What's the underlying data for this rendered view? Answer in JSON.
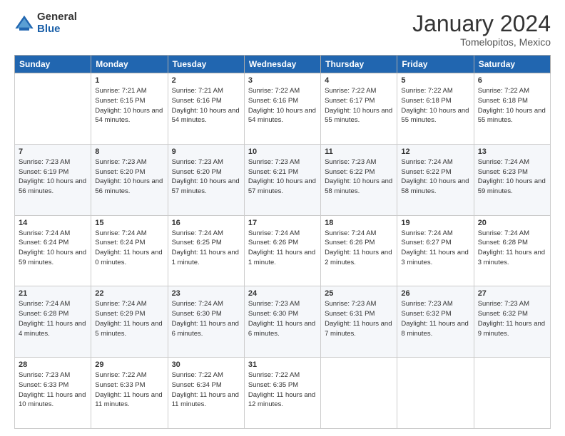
{
  "header": {
    "logo_general": "General",
    "logo_blue": "Blue",
    "main_title": "January 2024",
    "subtitle": "Tomelopitos, Mexico"
  },
  "weekdays": [
    "Sunday",
    "Monday",
    "Tuesday",
    "Wednesday",
    "Thursday",
    "Friday",
    "Saturday"
  ],
  "weeks": [
    [
      {
        "day": "",
        "sunrise": "",
        "sunset": "",
        "daylight": ""
      },
      {
        "day": "1",
        "sunrise": "Sunrise: 7:21 AM",
        "sunset": "Sunset: 6:15 PM",
        "daylight": "Daylight: 10 hours and 54 minutes."
      },
      {
        "day": "2",
        "sunrise": "Sunrise: 7:21 AM",
        "sunset": "Sunset: 6:16 PM",
        "daylight": "Daylight: 10 hours and 54 minutes."
      },
      {
        "day": "3",
        "sunrise": "Sunrise: 7:22 AM",
        "sunset": "Sunset: 6:16 PM",
        "daylight": "Daylight: 10 hours and 54 minutes."
      },
      {
        "day": "4",
        "sunrise": "Sunrise: 7:22 AM",
        "sunset": "Sunset: 6:17 PM",
        "daylight": "Daylight: 10 hours and 55 minutes."
      },
      {
        "day": "5",
        "sunrise": "Sunrise: 7:22 AM",
        "sunset": "Sunset: 6:18 PM",
        "daylight": "Daylight: 10 hours and 55 minutes."
      },
      {
        "day": "6",
        "sunrise": "Sunrise: 7:22 AM",
        "sunset": "Sunset: 6:18 PM",
        "daylight": "Daylight: 10 hours and 55 minutes."
      }
    ],
    [
      {
        "day": "7",
        "sunrise": "Sunrise: 7:23 AM",
        "sunset": "Sunset: 6:19 PM",
        "daylight": "Daylight: 10 hours and 56 minutes."
      },
      {
        "day": "8",
        "sunrise": "Sunrise: 7:23 AM",
        "sunset": "Sunset: 6:20 PM",
        "daylight": "Daylight: 10 hours and 56 minutes."
      },
      {
        "day": "9",
        "sunrise": "Sunrise: 7:23 AM",
        "sunset": "Sunset: 6:20 PM",
        "daylight": "Daylight: 10 hours and 57 minutes."
      },
      {
        "day": "10",
        "sunrise": "Sunrise: 7:23 AM",
        "sunset": "Sunset: 6:21 PM",
        "daylight": "Daylight: 10 hours and 57 minutes."
      },
      {
        "day": "11",
        "sunrise": "Sunrise: 7:23 AM",
        "sunset": "Sunset: 6:22 PM",
        "daylight": "Daylight: 10 hours and 58 minutes."
      },
      {
        "day": "12",
        "sunrise": "Sunrise: 7:24 AM",
        "sunset": "Sunset: 6:22 PM",
        "daylight": "Daylight: 10 hours and 58 minutes."
      },
      {
        "day": "13",
        "sunrise": "Sunrise: 7:24 AM",
        "sunset": "Sunset: 6:23 PM",
        "daylight": "Daylight: 10 hours and 59 minutes."
      }
    ],
    [
      {
        "day": "14",
        "sunrise": "Sunrise: 7:24 AM",
        "sunset": "Sunset: 6:24 PM",
        "daylight": "Daylight: 10 hours and 59 minutes."
      },
      {
        "day": "15",
        "sunrise": "Sunrise: 7:24 AM",
        "sunset": "Sunset: 6:24 PM",
        "daylight": "Daylight: 11 hours and 0 minutes."
      },
      {
        "day": "16",
        "sunrise": "Sunrise: 7:24 AM",
        "sunset": "Sunset: 6:25 PM",
        "daylight": "Daylight: 11 hours and 1 minute."
      },
      {
        "day": "17",
        "sunrise": "Sunrise: 7:24 AM",
        "sunset": "Sunset: 6:26 PM",
        "daylight": "Daylight: 11 hours and 1 minute."
      },
      {
        "day": "18",
        "sunrise": "Sunrise: 7:24 AM",
        "sunset": "Sunset: 6:26 PM",
        "daylight": "Daylight: 11 hours and 2 minutes."
      },
      {
        "day": "19",
        "sunrise": "Sunrise: 7:24 AM",
        "sunset": "Sunset: 6:27 PM",
        "daylight": "Daylight: 11 hours and 3 minutes."
      },
      {
        "day": "20",
        "sunrise": "Sunrise: 7:24 AM",
        "sunset": "Sunset: 6:28 PM",
        "daylight": "Daylight: 11 hours and 3 minutes."
      }
    ],
    [
      {
        "day": "21",
        "sunrise": "Sunrise: 7:24 AM",
        "sunset": "Sunset: 6:28 PM",
        "daylight": "Daylight: 11 hours and 4 minutes."
      },
      {
        "day": "22",
        "sunrise": "Sunrise: 7:24 AM",
        "sunset": "Sunset: 6:29 PM",
        "daylight": "Daylight: 11 hours and 5 minutes."
      },
      {
        "day": "23",
        "sunrise": "Sunrise: 7:24 AM",
        "sunset": "Sunset: 6:30 PM",
        "daylight": "Daylight: 11 hours and 6 minutes."
      },
      {
        "day": "24",
        "sunrise": "Sunrise: 7:23 AM",
        "sunset": "Sunset: 6:30 PM",
        "daylight": "Daylight: 11 hours and 6 minutes."
      },
      {
        "day": "25",
        "sunrise": "Sunrise: 7:23 AM",
        "sunset": "Sunset: 6:31 PM",
        "daylight": "Daylight: 11 hours and 7 minutes."
      },
      {
        "day": "26",
        "sunrise": "Sunrise: 7:23 AM",
        "sunset": "Sunset: 6:32 PM",
        "daylight": "Daylight: 11 hours and 8 minutes."
      },
      {
        "day": "27",
        "sunrise": "Sunrise: 7:23 AM",
        "sunset": "Sunset: 6:32 PM",
        "daylight": "Daylight: 11 hours and 9 minutes."
      }
    ],
    [
      {
        "day": "28",
        "sunrise": "Sunrise: 7:23 AM",
        "sunset": "Sunset: 6:33 PM",
        "daylight": "Daylight: 11 hours and 10 minutes."
      },
      {
        "day": "29",
        "sunrise": "Sunrise: 7:22 AM",
        "sunset": "Sunset: 6:33 PM",
        "daylight": "Daylight: 11 hours and 11 minutes."
      },
      {
        "day": "30",
        "sunrise": "Sunrise: 7:22 AM",
        "sunset": "Sunset: 6:34 PM",
        "daylight": "Daylight: 11 hours and 11 minutes."
      },
      {
        "day": "31",
        "sunrise": "Sunrise: 7:22 AM",
        "sunset": "Sunset: 6:35 PM",
        "daylight": "Daylight: 11 hours and 12 minutes."
      },
      {
        "day": "",
        "sunrise": "",
        "sunset": "",
        "daylight": ""
      },
      {
        "day": "",
        "sunrise": "",
        "sunset": "",
        "daylight": ""
      },
      {
        "day": "",
        "sunrise": "",
        "sunset": "",
        "daylight": ""
      }
    ]
  ]
}
